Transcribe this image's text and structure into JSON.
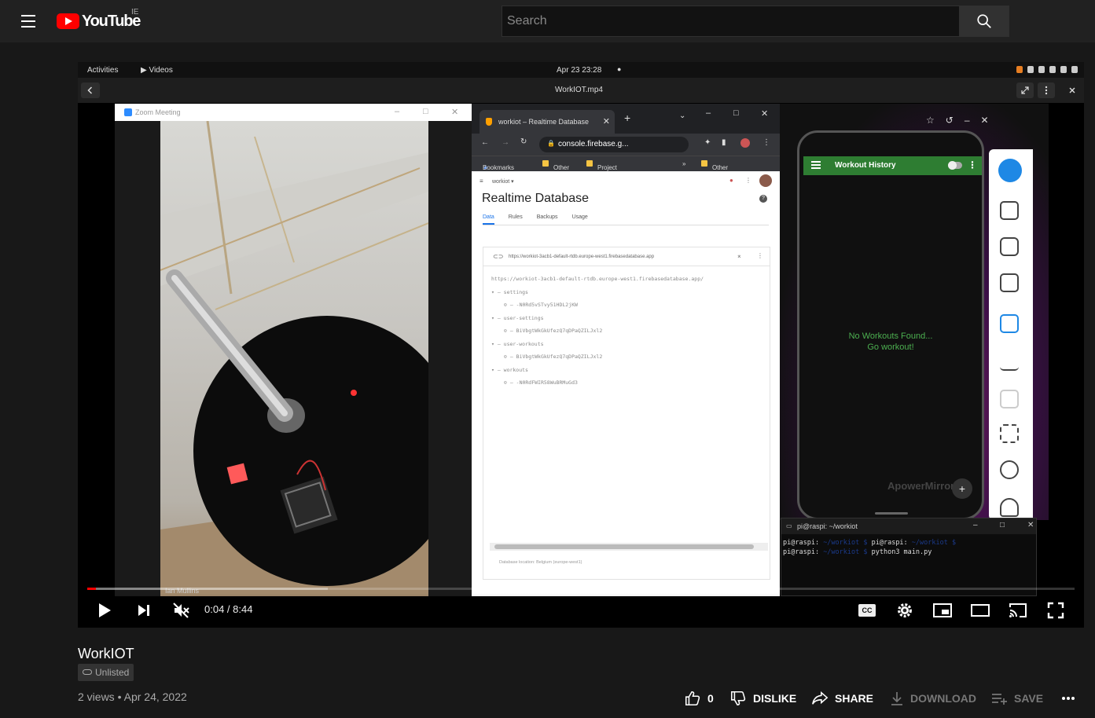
{
  "header": {
    "logo_text": "YouTube",
    "country_code": "IE",
    "search_placeholder": "Search"
  },
  "desktop": {
    "activities": "Activities",
    "videos_app": "Videos",
    "clock": "Apr 23  23:28",
    "viewer_title": "WorkIOT.mp4"
  },
  "zoom": {
    "title": "Zoom Meeting",
    "participant": "Ian Mullins"
  },
  "chrome": {
    "tab_title": "workiot – Realtime Database",
    "url": "console.firebase.g...",
    "bookmarks": [
      "Bookmarks",
      "Other",
      "Project"
    ],
    "other_bookmarks": "Other bookmarks",
    "project_name": "workiot",
    "page_title": "Realtime Database",
    "tabs": [
      "Data",
      "Rules",
      "Backups",
      "Usage"
    ],
    "db_url_short": "https://workiot-3acb1-default-rtdb.europe-west1.firebasedatabase.app",
    "db_url": "https://workiot-3acb1-default-rtdb.europe-west1.firebasedatabase.app/",
    "tree": [
      {
        "key": "settings",
        "child": "-N0Rd5vSTvy51HDL2jKW"
      },
      {
        "key": "user-settings",
        "child": "BiVbgtWkGkUfezQ7qDPaQZILJxl2"
      },
      {
        "key": "user-workouts",
        "child": "BiVbgtWkGkUfezQ7qDPaQZILJxl2"
      },
      {
        "key": "workouts",
        "child": "-N0RdFWIR58WuBRMuGd3"
      }
    ],
    "db_location": "Database location: Belgium (europe-west1)"
  },
  "phone": {
    "app_title": "Workout History",
    "empty_line1": "No Workouts Found...",
    "empty_line2": "Go workout!",
    "watermark": "ApowerMirror",
    "fab": "+"
  },
  "terminal": {
    "title": "pi@raspi: ~/workiot",
    "line1_user": "pi@raspi:",
    "line1_user2": "pi@raspi:",
    "line2_user": "pi@raspi:",
    "line2_cmd": "python3 main.py"
  },
  "player": {
    "time": "0:04 / 8:44",
    "cc_label": "CC",
    "progress_played_fraction": 0.009,
    "progress_loaded_fraction": 0.244
  },
  "video": {
    "title": "WorkIOT",
    "visibility": "Unlisted",
    "views": "2 views",
    "date": "Apr 24, 2022",
    "separator": "•"
  },
  "actions": {
    "like_count": "0",
    "dislike": "DISLIKE",
    "share": "SHARE",
    "download": "DOWNLOAD",
    "save": "SAVE"
  }
}
